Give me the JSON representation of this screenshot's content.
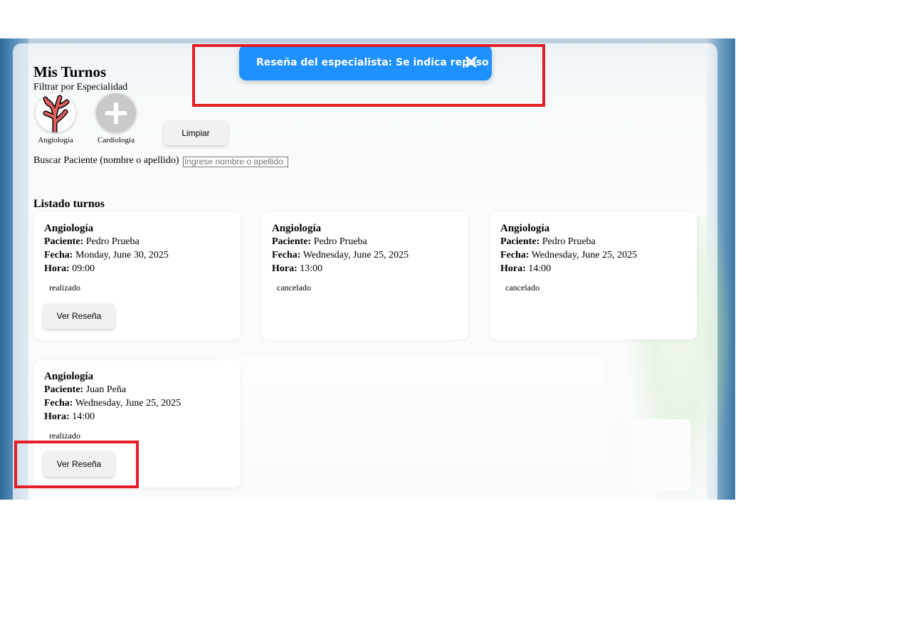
{
  "page": {
    "title": "Mis Turnos"
  },
  "filter": {
    "label": "Filtrar por Especialidad",
    "specialties": [
      {
        "name": "Angiología",
        "icon": "blood-vessel-icon"
      },
      {
        "name": "Cardiología",
        "icon": "plus-icon"
      }
    ],
    "clear_label": "Limpiar"
  },
  "search": {
    "label": "Buscar Paciente (nombre o apellido)",
    "placeholder": "Ingrese nombre o apellido",
    "value": ""
  },
  "list": {
    "title": "Listado turnos",
    "patient_label": "Paciente:",
    "date_label": "Fecha:",
    "time_label": "Hora:",
    "review_label": "Ver Reseña",
    "items": [
      {
        "specialty": "Angiología",
        "patient": "Pedro Prueba",
        "date": "Monday, June 30, 2025",
        "time": "09:00",
        "status": "realizado"
      },
      {
        "specialty": "Angiología",
        "patient": "Pedro Prueba",
        "date": "Wednesday, June 25, 2025",
        "time": "13:00",
        "status": "cancelado"
      },
      {
        "specialty": "Angiología",
        "patient": "Pedro Prueba",
        "date": "Wednesday, June 25, 2025",
        "time": "14:00",
        "status": "cancelado"
      },
      {
        "specialty": "Angiología",
        "patient": "Juan Peña",
        "date": "Wednesday, June 25, 2025",
        "time": "14:00",
        "status": "realizado"
      }
    ]
  },
  "toast": {
    "message": "Reseña del especialista: Se indica reposo",
    "color": "#1e90ff",
    "close_icon": "close-icon"
  },
  "highlight_color": "#e41e26"
}
